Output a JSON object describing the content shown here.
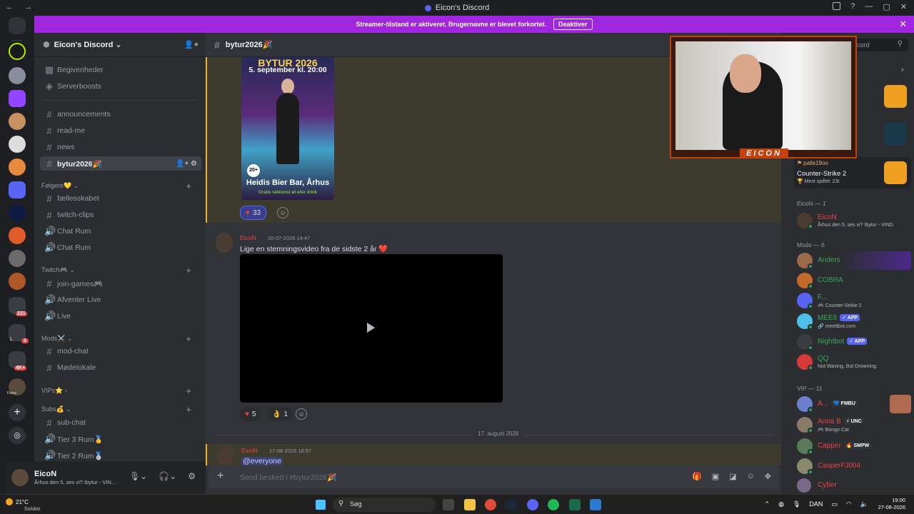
{
  "window": {
    "title": "Eicon's Discord",
    "nav": "← →"
  },
  "banner": {
    "text": "Streamer-tilstand er aktiveret. Brugernavne er blevet forkortet.",
    "button": "Deaktiver",
    "close": "✕"
  },
  "server": {
    "name": "Eicon's Discord ⌄"
  },
  "sidebar": {
    "top_items": [
      {
        "label": "Begivenheder"
      },
      {
        "label": "Serverboosts"
      }
    ],
    "channels": [
      {
        "label": "announcements"
      },
      {
        "label": "read-me"
      },
      {
        "label": "news"
      },
      {
        "label": "bytur2026🎉"
      }
    ],
    "cat_folgere": "Følgere💛 ⌄",
    "folgere": [
      {
        "label": "fællesskabet"
      },
      {
        "label": "twitch-clips"
      },
      {
        "label": "Chat Rum"
      },
      {
        "label": "Chat Rum"
      }
    ],
    "cat_twitch": "Twitch🎮 ⌄",
    "twitch": [
      {
        "label": "join-games🎮"
      },
      {
        "label": "Afventer Live"
      },
      {
        "label": "Live"
      }
    ],
    "cat_mods": "Mods⚔️ ⌄",
    "mods": [
      {
        "label": "mod-chat"
      },
      {
        "label": "Mødelokale"
      }
    ],
    "cat_vips": "VIPs⭐ ›",
    "cat_subs": "Subs💰 ⌄",
    "subs": [
      {
        "label": "sub-chat"
      },
      {
        "label": "Tier 3 Rum🥇"
      },
      {
        "label": "Tier 2 Rum🥈"
      }
    ]
  },
  "user": {
    "name": "EicoN",
    "status": "Århus den 5, ses vi? Ibytur - VIN..."
  },
  "channel": {
    "name": "bytur2026🎉"
  },
  "poster": {
    "title": "BYTUR 2026",
    "date": "5. september kl. 20:00",
    "age": "20+",
    "venue": "Heidis Bier Bar, Århus",
    "note": "Gratis velkomst øl eller drink"
  },
  "messages": {
    "reaction1_count": "33",
    "m1_name": "EicoN",
    "m1_time": "20-07-2026 14:47",
    "m1_text": "Lige en stemningsvideo fra de sidste 2 år ❤️",
    "r_heart": "5",
    "r_ok": "1",
    "date_divider": "17. august 2026",
    "m2_name": "EicoN",
    "m2_time": "17-08-2026 18:57",
    "m2_text": "@everyone"
  },
  "composer": {
    "placeholder": "Send besked i #bytur2026🎉"
  },
  "search": {
    "placeholder": "cord"
  },
  "activity": {
    "user": "palle19oo",
    "game": "Counter-Strike 2",
    "sub": "🏆 Mest spillet: 23t"
  },
  "webcam": {
    "label": "EICON"
  },
  "members": {
    "eicon_group": "EicoN — 1",
    "eicon": {
      "name": "EicoN",
      "sub": "Århus den 5, ses vi? Ibytur - VIND"
    },
    "mods_group": "Mods — 6",
    "mods": [
      {
        "name": "Anders",
        "sub": ""
      },
      {
        "name": "COBRA",
        "sub": ""
      },
      {
        "name": "F...",
        "sub": "🎮 Counter-Strike 2"
      },
      {
        "name": "MEE6",
        "tag": "✓ APP",
        "sub": "🔗 mee6bot.com"
      },
      {
        "name": "Nightbot",
        "tag": "✓ APP",
        "sub": ""
      },
      {
        "name": "QQ",
        "sub": "Not Waving, But Drowning."
      }
    ],
    "vip_group": "VIP — 11",
    "vips": [
      {
        "name": "A...",
        "tag": "💙 FMBU",
        "sub": ""
      },
      {
        "name": "Anna B",
        "tag": "⚡ UNC",
        "sub": "🎮 Bongo Cat"
      },
      {
        "name": "Capper",
        "tag": "🔥 SMPW",
        "sub": ""
      },
      {
        "name": "CasperFJ004",
        "tag": "",
        "sub": ""
      },
      {
        "name": "Cyber",
        "tag": "",
        "sub": ""
      }
    ]
  },
  "guild_badges": {
    "b1": "231",
    "b2": "3",
    "b3": "4K+",
    "label_l": "L",
    "label_fame": "Fame"
  },
  "taskbar": {
    "temp": "21°C",
    "weather": "Solskin",
    "search": "Søg",
    "lang": "DAN",
    "time": "19:00",
    "date": "27-08-2026"
  },
  "colors": {
    "accent": "#a126e0",
    "mention_bg": "#3d3a2e",
    "live": "#23a55a",
    "mod_green": "#3ba55c",
    "vip_red": "#ed4245"
  }
}
